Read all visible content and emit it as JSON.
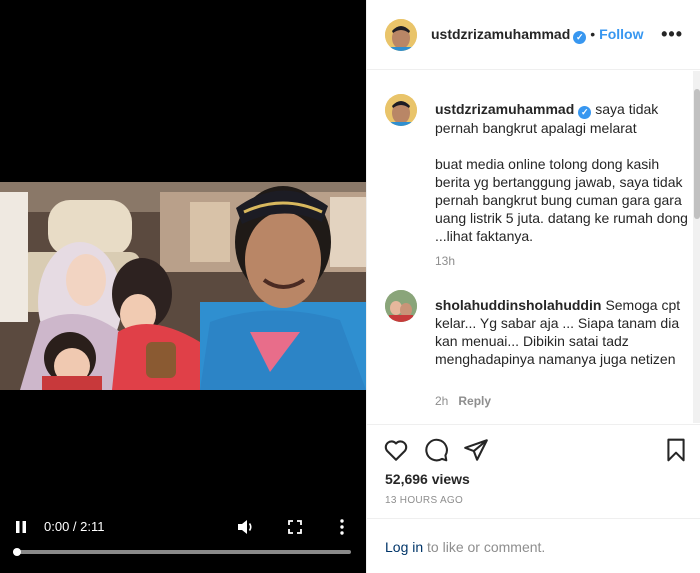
{
  "video": {
    "time_display": "0:00 / 2:11",
    "progress_fraction": 0.0
  },
  "post": {
    "username": "ustdzrizamuhammad",
    "follow_label": "Follow",
    "dot": "•",
    "more_label": "•••",
    "caption_first": "saya tidak pernah bangkrut apalagi melarat",
    "caption_second": "buat media online tolong dong kasih berita yg bertanggung jawab, saya tidak pernah bangkrut bung cuman gara gara uang listrik 5 juta. datang ke rumah dong ...lihat faktanya.",
    "caption_age": "13h"
  },
  "comments": [
    {
      "username": "sholahuddinsholahuddin",
      "text": "Semoga cpt kelar... Yg sabar aja ... Siapa tanam dia kan menuai... Dibikin satai tadz menghadapinya namanya juga netizen",
      "age": "2h",
      "reply_label": "Reply"
    }
  ],
  "stats": {
    "views": "52,696 views",
    "posted": "13 HOURS AGO"
  },
  "footer": {
    "login_label": "Log in",
    "rest": " to like or comment."
  },
  "icons": {
    "verified": "verified-badge-icon",
    "like": "heart-icon",
    "comment": "comment-bubble-icon",
    "share": "paper-plane-icon",
    "save": "bookmark-icon"
  },
  "colors": {
    "link_blue": "#3897f0",
    "muted": "#8e8e8e",
    "text": "#262626"
  }
}
